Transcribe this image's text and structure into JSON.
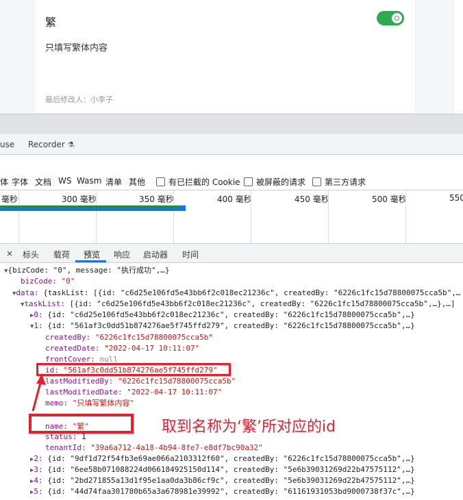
{
  "card": {
    "title": "繁",
    "description": "只填写繁体内容",
    "footer": "最后修改人：小李子",
    "toggle_on": true,
    "accent_color": "#2fa84f"
  },
  "devtools": {
    "tabs": [
      "use",
      "Recorder"
    ],
    "recorder_icon": "flask-icon",
    "filters": [
      "体",
      "字体",
      "文档",
      "WS",
      "Wasm",
      "清单",
      "其他"
    ],
    "checkboxes": [
      "有已拦截的 Cookie",
      "被屏蔽的请求",
      "第三方请求"
    ],
    "timeline_ticks": [
      "毫秒",
      "300 毫秒",
      "350 毫秒",
      "400 毫秒",
      "450 毫秒",
      "500 毫秒",
      "550"
    ],
    "response_tabs": [
      "×",
      "标头",
      "载荷",
      "预览",
      "响应",
      "启动器",
      "时间"
    ],
    "active_tab": "预览"
  },
  "tree": {
    "root": "{bizCode: \"0\", message: \"执行成功\",…}",
    "bizCode_key": "bizCode:",
    "bizCode_val": "\"0\"",
    "data_key": "data:",
    "data_val": "{taskList: [{id: \"c6d25e106fd5e43bb6f2c018ec21236c\", createdBy: \"6226c1fc15d78800075cca5b\",…",
    "taskList_key": "taskList:",
    "taskList_val": "[{id: \"c6d25e106fd5e43bb6f2c018ec21236c\", createdBy: \"6226c1fc15d78800075cca5b\",…},…]",
    "item0_key": "0:",
    "item0_val": "{id: \"c6d25e106fd5e43bb6f2c018ec21236c\", createdBy: \"6226c1fc15d78800075cca5b\",…}",
    "item1_key": "1:",
    "item1_val": "{id: \"561af3c0dd51b874276ae5f745ffd279\", createdBy: \"6226c1fc15d78800075cca5b\",…}",
    "createdBy_key": "createdBy:",
    "createdBy_val": "\"6226c1fc15d78800075cca5b\"",
    "createdDate_key": "createdDate:",
    "createdDate_val": "\"2022-04-17 10:11:07\"",
    "frontCover_key": "frontCover:",
    "frontCover_val": "null",
    "id_key": "id:",
    "id_val": "\"561af3c0dd51b874276ae5f745ffd279\"",
    "lastModifiedBy_key": "lastModifiedBy:",
    "lastModifiedBy_val": "\"6226c1fc15d78800075cca5b\"",
    "lastModifiedDate_key": "lastModifiedDate:",
    "lastModifiedDate_val": "\"2022-04-17 10:11:07\"",
    "memo_key": "memo:",
    "memo_val": "\"只填写繁体内容\"",
    "name_key": "name:",
    "name_val": "\"繁\"",
    "status_key": "status:",
    "status_val": "1",
    "tenantId_key": "tenantId:",
    "tenantId_val": "\"39a6a712-4a18-4b94-8fe7-e8df7bc90a32\"",
    "item2_key": "2:",
    "item2_val": "{id: \"9df1d72f54fb3e69ae066a2103312f60\", createdBy: \"6226c1fc15d78800075cca5b\",…}",
    "item3_key": "3:",
    "item3_val": "{id: \"6ee58b071088224d066184925150d114\", createdBy: \"5e6b39031269d22b47575112\",…}",
    "item4_key": "4:",
    "item4_val": "{id: \"2bd271855a13d1f95e1aa0da3b86cf9c\", createdBy: \"5e6b39031269d22b47575112\",…}",
    "item5_key": "5:",
    "item5_val": "{id: \"44d74faa301780b65a3a678981e39992\", createdBy: \"61161931053bd9000738f37c\",…}"
  },
  "annotation": {
    "text": "取到名称为‘繁’所对应的id",
    "color": "#ea1d2c"
  }
}
